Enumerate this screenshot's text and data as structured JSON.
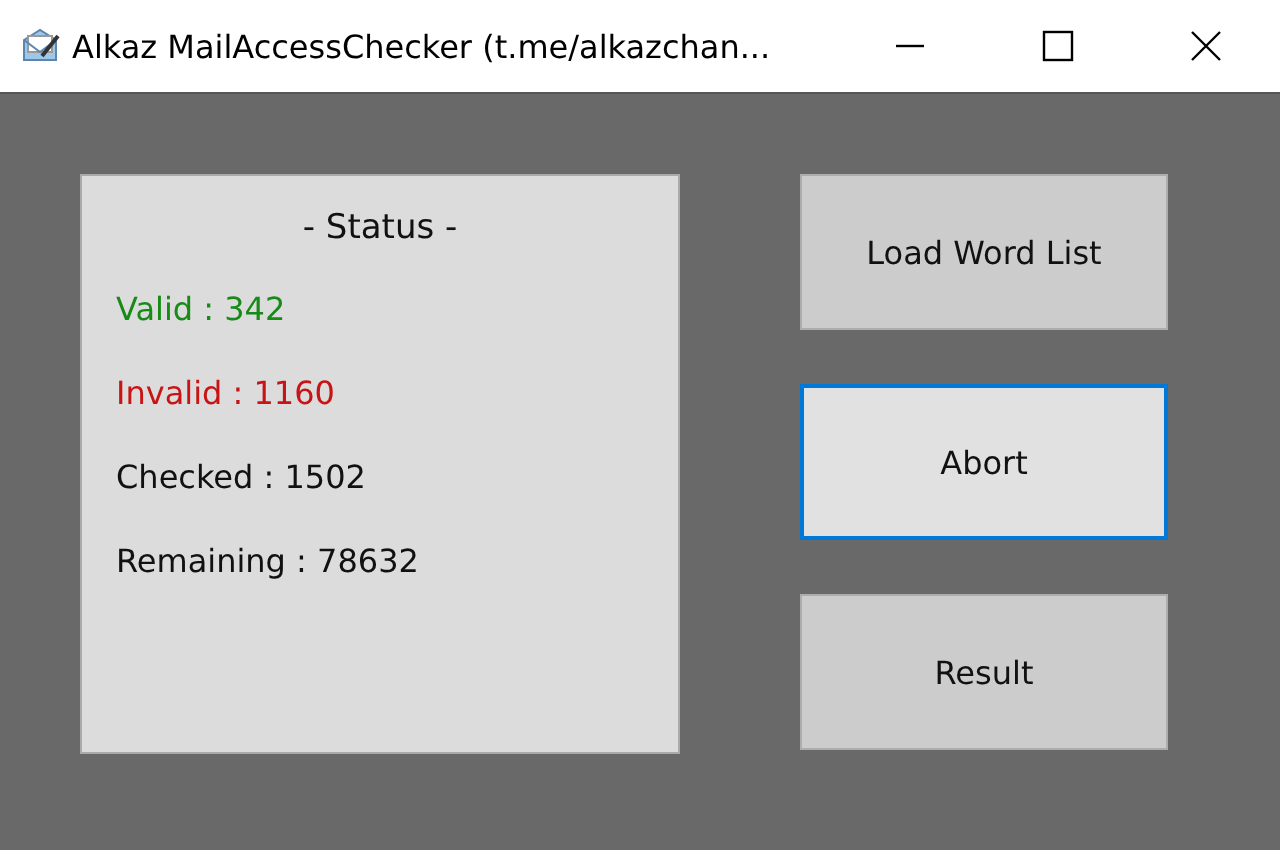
{
  "window": {
    "title": "Alkaz MailAccessChecker (t.me/alkazchan..."
  },
  "status_panel": {
    "heading": "- Status -",
    "stats": [
      {
        "label": "Valid : 342",
        "color": "#178a17"
      },
      {
        "label": "Invalid : 1160",
        "color": "#c81414"
      },
      {
        "label": "Checked : 1502",
        "color": "#111111"
      },
      {
        "label": "Remaining : 78632",
        "color": "#111111"
      }
    ]
  },
  "buttons": [
    {
      "label": "Load Word List",
      "focused": false
    },
    {
      "label": "Abort",
      "focused": true
    },
    {
      "label": "Result",
      "focused": false
    }
  ]
}
